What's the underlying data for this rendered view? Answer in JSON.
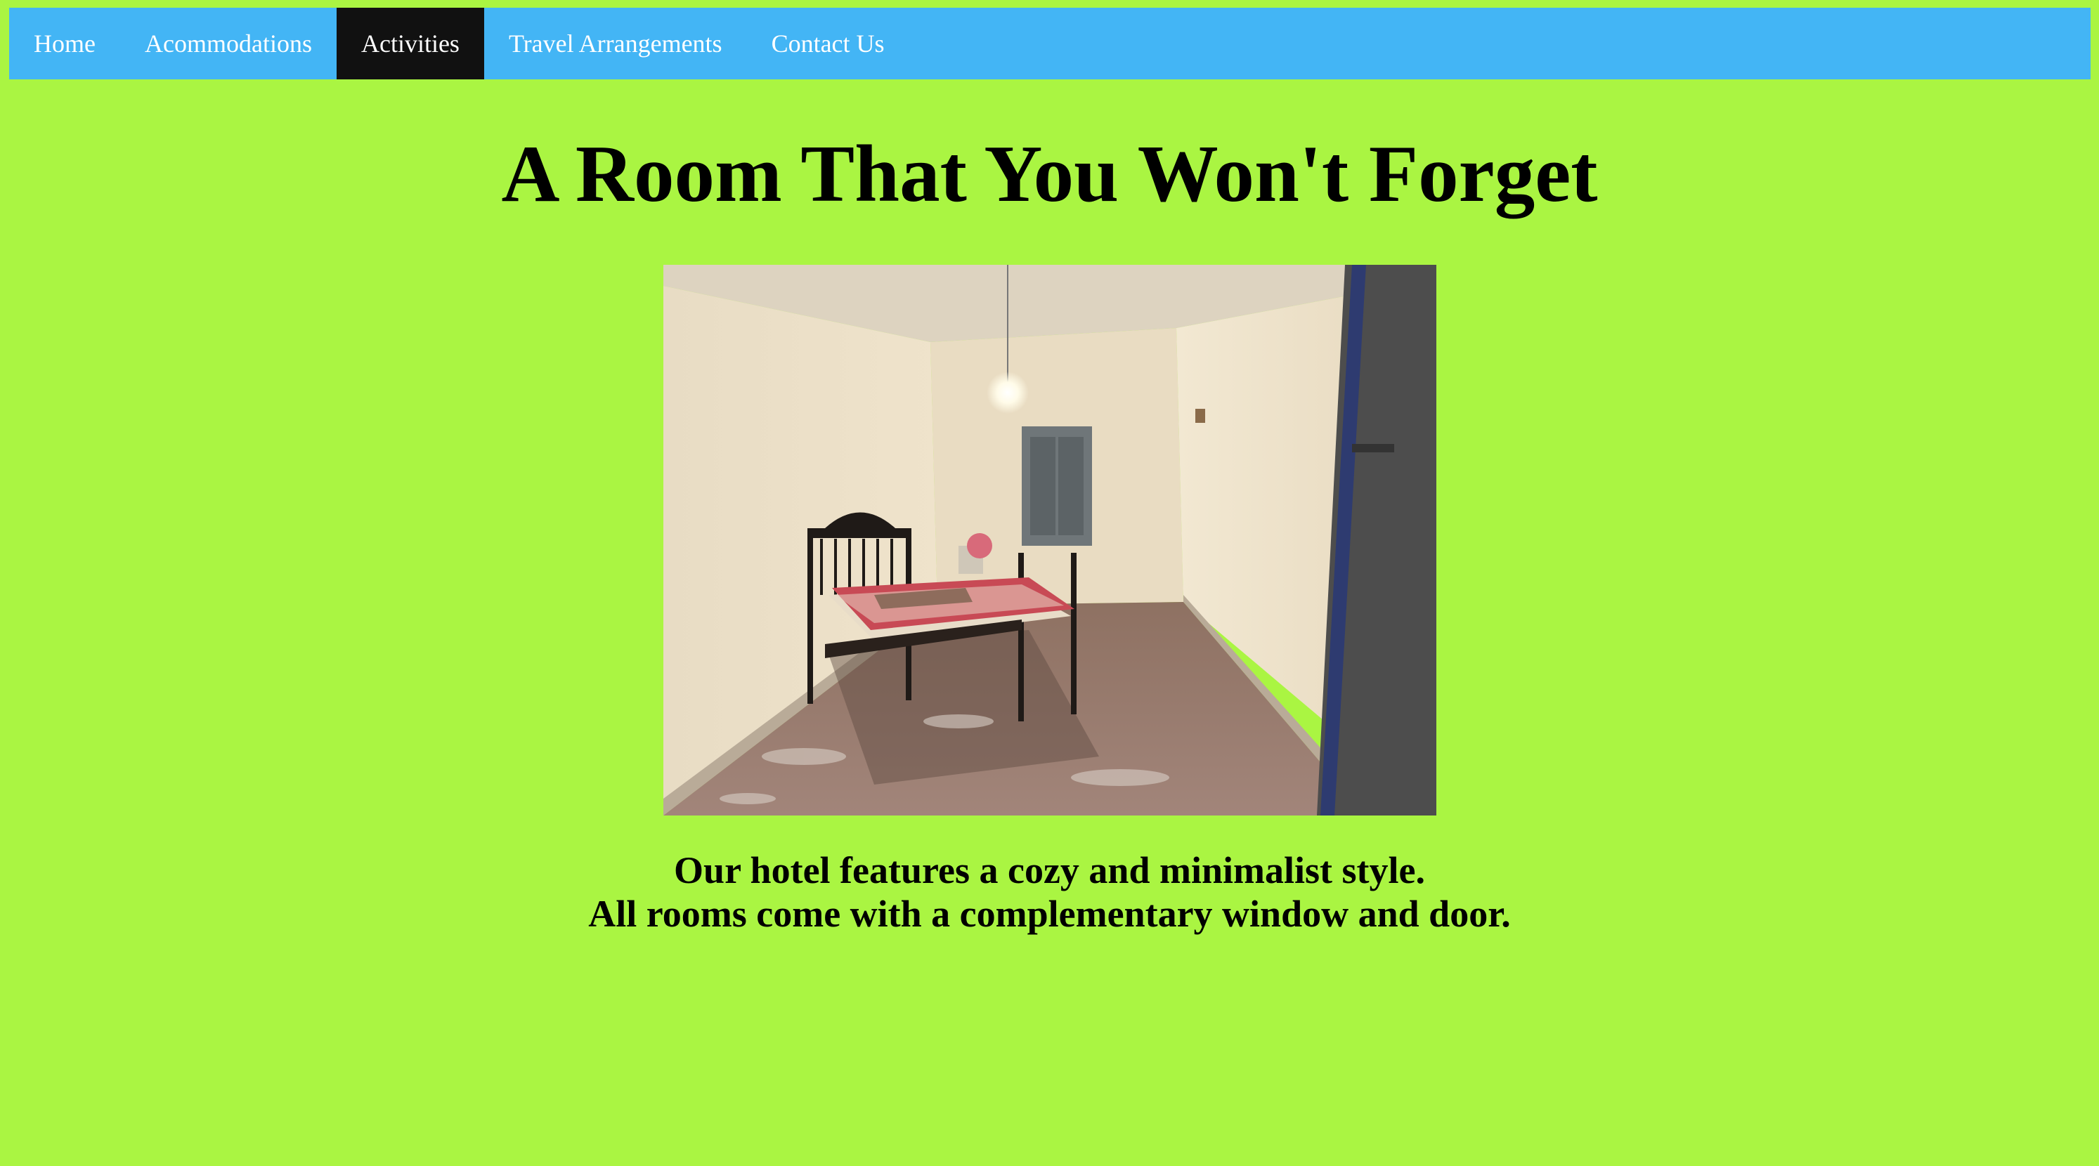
{
  "nav": {
    "items": [
      {
        "label": "Home",
        "active": false
      },
      {
        "label": "Acommodations",
        "active": false
      },
      {
        "label": "Activities",
        "active": true
      },
      {
        "label": "Travel Arrangements",
        "active": false
      },
      {
        "label": "Contact Us",
        "active": false
      }
    ]
  },
  "main": {
    "title": "A Room That You Won't Forget",
    "image_alt": "hotel-room-photo",
    "caption_lines": [
      "Our hotel features a cozy and minimalist style.",
      "All rooms come with a complementary window and door."
    ]
  },
  "colors": {
    "background": "#aaf542",
    "navbar": "#43b5f5",
    "nav_active": "#111111",
    "nav_text": "#ffffff"
  }
}
